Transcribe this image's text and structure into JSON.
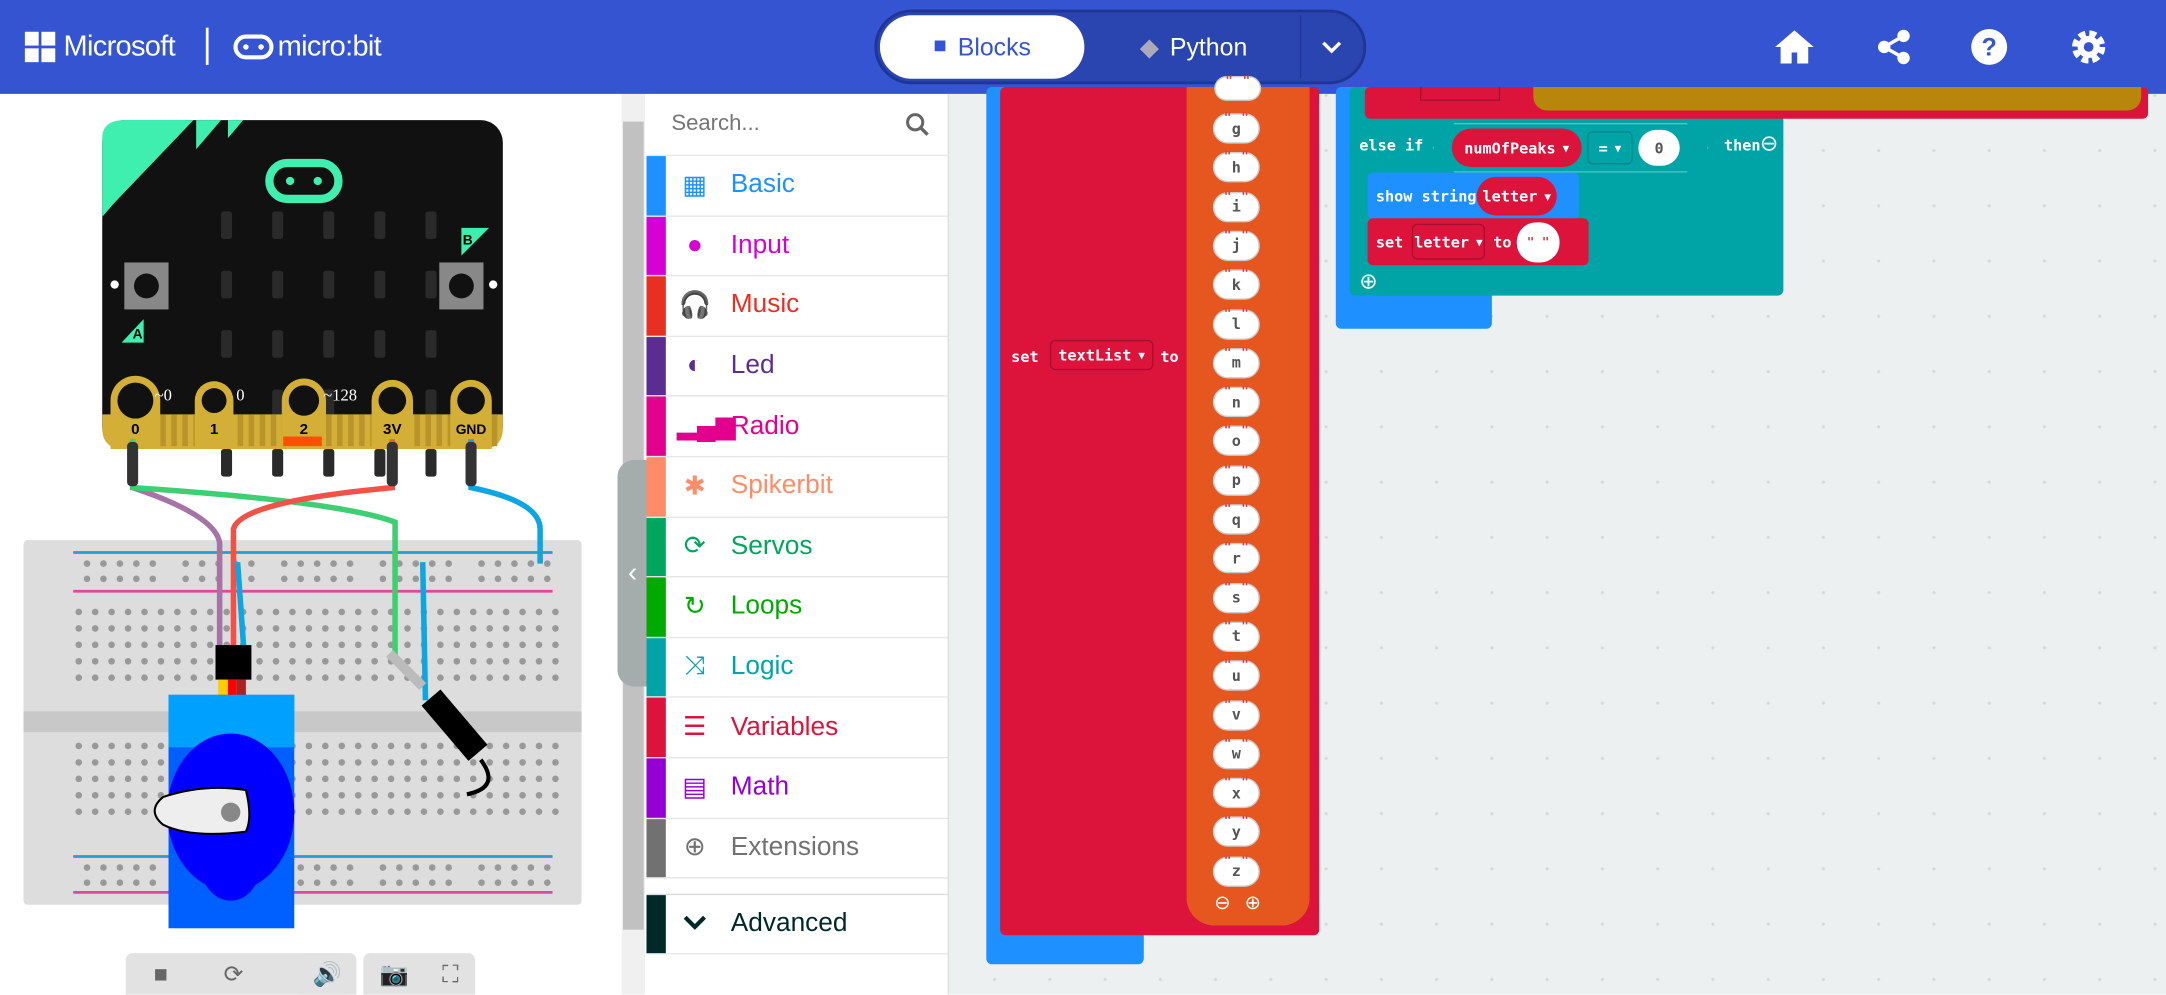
{
  "header": {
    "brand": "Microsoft",
    "product": "micro:bit",
    "modes": {
      "blocks": "Blocks",
      "python": "Python"
    },
    "icons": [
      "home-icon",
      "share-icon",
      "help-icon",
      "settings-icon"
    ],
    "color": "#3454D1"
  },
  "simulator": {
    "pins": {
      "p0": "0",
      "p1": "1",
      "p2": "2",
      "p3v": "3V",
      "gnd": "GND"
    },
    "pin_values": {
      "p0": "~0",
      "p1": "0",
      "p2": "~128"
    },
    "buttons": {
      "a": "A",
      "b": "B"
    },
    "toolbar": [
      "stop-icon",
      "restart-icon",
      "debug-icon",
      "sound-icon",
      "screenshot-icon",
      "fullscreen-icon"
    ]
  },
  "toolbox": {
    "search_placeholder": "Search...",
    "categories": [
      {
        "label": "Basic",
        "color": "#1E90FF",
        "icon": "▦"
      },
      {
        "label": "Input",
        "color": "#D400D4",
        "icon": "●"
      },
      {
        "label": "Music",
        "color": "#E63022",
        "icon": "🎧"
      },
      {
        "label": "Led",
        "color": "#5C2D91",
        "icon": "◐"
      },
      {
        "label": "Radio",
        "color": "#E3008C",
        "icon": "▂▄▆"
      },
      {
        "label": "Spikerbit",
        "color": "#FF8C69",
        "icon": "✱"
      },
      {
        "label": "Servos",
        "color": "#00A65D",
        "icon": "⟳"
      },
      {
        "label": "Loops",
        "color": "#00AA00",
        "icon": "↻"
      },
      {
        "label": "Logic",
        "color": "#00A4A6",
        "icon": "⤨"
      },
      {
        "label": "Variables",
        "color": "#DC143C",
        "icon": "☰"
      },
      {
        "label": "Math",
        "color": "#9400D3",
        "icon": "▤"
      },
      {
        "label": "Extensions",
        "color": "#717171",
        "icon": "⊕"
      }
    ],
    "advanced": {
      "label": "Advanced",
      "color": "#002828"
    }
  },
  "workspace": {
    "set_block": {
      "set": "set",
      "variable": "textList",
      "to": "to"
    },
    "letters": [
      "g",
      "h",
      "i",
      "j",
      "k",
      "l",
      "m",
      "n",
      "o",
      "p",
      "q",
      "r",
      "s",
      "t",
      "u",
      "v",
      "w",
      "x",
      "y",
      "z"
    ],
    "else_if": {
      "label": "else if",
      "variable": "numOfPeaks",
      "operator": "=",
      "value": "0",
      "then": "then"
    },
    "show_string": {
      "label": "show string",
      "variable": "letter"
    },
    "set_letter": {
      "set": "set",
      "variable": "letter",
      "to": "to",
      "value": "\" \""
    }
  }
}
